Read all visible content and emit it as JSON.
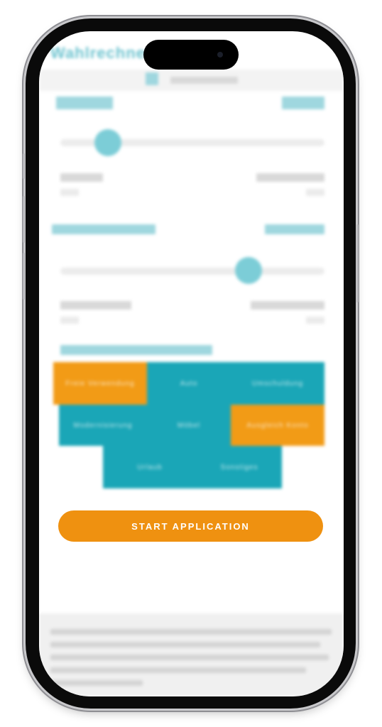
{
  "app": {
    "logo_text": "Wahlrechner",
    "subtitle": "Rechner"
  },
  "amount": {
    "label": "Kreditbetrag",
    "value": "10.000 €",
    "slider_level": 0.12,
    "min_label": "1.000 €",
    "min_sub": "Min",
    "max_label": "100.000 €",
    "max_sub": "Max"
  },
  "term": {
    "label": "Laufzeit in Monaten",
    "value": "84 Monate",
    "slider_level": 0.72,
    "min_label": "12 Monate",
    "min_sub": "Min",
    "max_label": "120 Monate",
    "max_sub": "Max"
  },
  "purpose": {
    "label": "Verwendungszweck",
    "options": [
      {
        "label": "Freie Verwendung",
        "selected": true
      },
      {
        "label": "Auto",
        "selected": false
      },
      {
        "label": "Umschuldung",
        "selected": false
      },
      {
        "label": "Modernisierung",
        "selected": false
      },
      {
        "label": "Möbel",
        "selected": false
      },
      {
        "label": "Ausgleich Konto",
        "selected": true
      },
      {
        "label": "Urlaub",
        "selected": false
      },
      {
        "label": "Sonstiges",
        "selected": false
      }
    ]
  },
  "cta": {
    "label": "START APPLICATION"
  },
  "footer": {
    "text": "Repräsentatives Beispiel"
  },
  "colors": {
    "accent_teal": "#1aa6b7",
    "accent_orange": "#ef9110"
  }
}
